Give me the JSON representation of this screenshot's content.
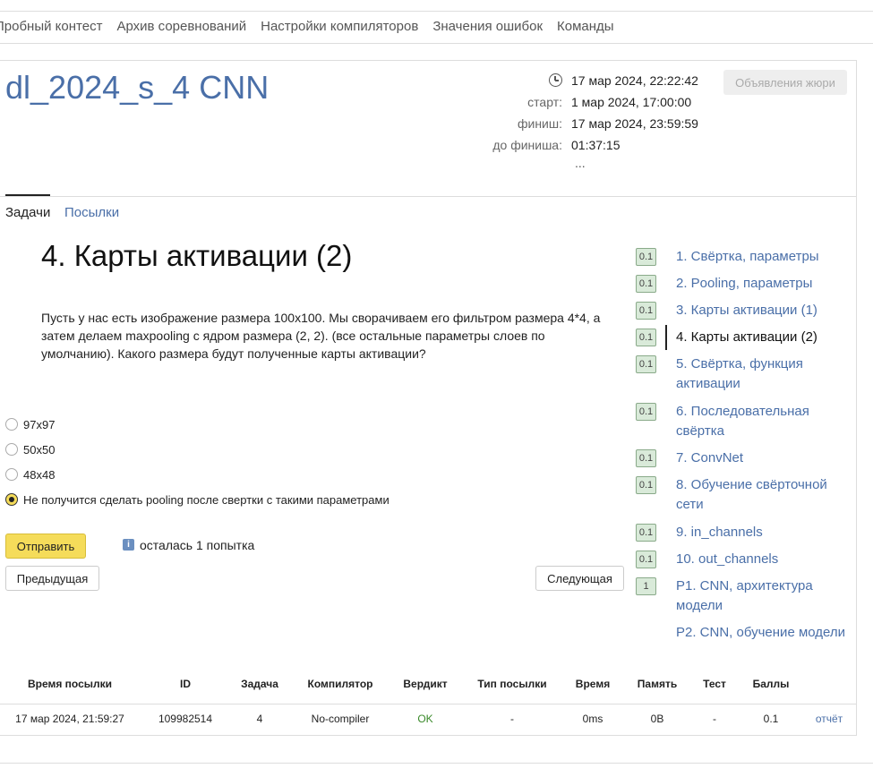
{
  "nav": [
    "Пробный контест",
    "Архив соревнований",
    "Настройки компиляторов",
    "Значения ошибок",
    "Команды"
  ],
  "contest": {
    "title": "dl_2024_s_4 CNN",
    "now_value": "17 мар 2024, 22:22:42",
    "start_label": "старт:",
    "start_value": "1 мар 2024, 17:00:00",
    "finish_label": "финиш:",
    "finish_value": "17 мар 2024, 23:59:59",
    "remaining_label": "до финиша:",
    "remaining_value": "01:37:15",
    "more": "...",
    "jury_button": "Объявления жюри"
  },
  "tabs": {
    "tasks": "Задачи",
    "submissions": "Посылки"
  },
  "problem": {
    "title": "4. Карты активации (2)",
    "text": "Пусть у нас есть изображение размера 100x100. Мы сворачиваем его фильтром размера 4*4, а затем делаем maxpooling с ядром размера (2, 2). (все остальные параметры слоев по умолчанию). Какого размера будут полученные карты активации?",
    "options": [
      "97x97",
      "50x50",
      "48x48",
      "Не получится сделать pooling после свертки с такими параметрами"
    ],
    "selected_index": 3,
    "submit_label": "Отправить",
    "attempts_text": "осталась 1 попытка",
    "prev_label": "Предыдущая",
    "next_label": "Следующая"
  },
  "problem_list": [
    {
      "score": "0.1",
      "label": "1. Свёртка, параметры"
    },
    {
      "score": "0.1",
      "label": "2. Pooling, параметры"
    },
    {
      "score": "0.1",
      "label": "3. Карты активации (1)"
    },
    {
      "score": "0.1",
      "label": "4. Карты активации (2)"
    },
    {
      "score": "0.1",
      "label": "5. Свёртка, функция активации"
    },
    {
      "score": "0.1",
      "label": "6. Последовательная свёртка"
    },
    {
      "score": "0.1",
      "label": "7. ConvNet"
    },
    {
      "score": "0.1",
      "label": "8. Обучение свёрточной сети"
    },
    {
      "score": "0.1",
      "label": "9. in_channels"
    },
    {
      "score": "0.1",
      "label": "10. out_channels"
    },
    {
      "score": "1",
      "label": "P1. CNN, архитектура модели"
    },
    {
      "score": "",
      "label": "P2. CNN, обучение модели"
    }
  ],
  "submissions": {
    "headers": [
      "Время посылки",
      "ID",
      "Задача",
      "Компилятор",
      "Вердикт",
      "Тип посылки",
      "Время",
      "Память",
      "Тест",
      "Баллы"
    ],
    "rows": [
      [
        "17 мар 2024, 21:59:27",
        "109982514",
        "4",
        "No-compiler",
        "OK",
        "-",
        "0ms",
        "0B",
        "-",
        "0.1",
        "отчёт"
      ]
    ]
  }
}
